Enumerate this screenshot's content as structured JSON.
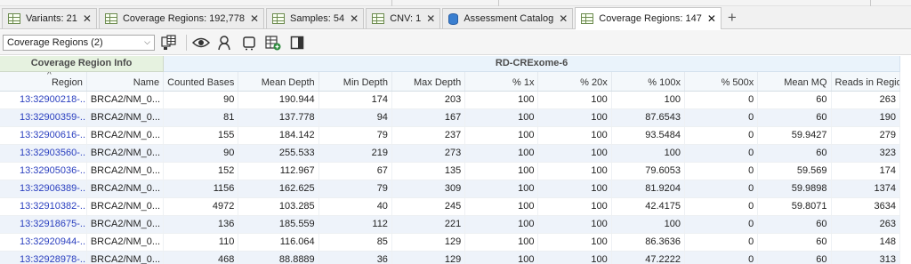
{
  "tabs": [
    {
      "label": "Variants: 21",
      "icon": "grid-icon",
      "active": false
    },
    {
      "label": "Coverage Regions: 192,778",
      "icon": "grid-icon",
      "active": false
    },
    {
      "label": "Samples: 54",
      "icon": "grid-icon",
      "active": false
    },
    {
      "label": "CNV: 1",
      "icon": "grid-icon",
      "active": false
    },
    {
      "label": "Assessment Catalog",
      "icon": "database-icon",
      "active": false
    },
    {
      "label": "Coverage Regions: 147",
      "icon": "grid-icon",
      "active": true
    }
  ],
  "tab_close_glyph": "✕",
  "new_tab_glyph": "+",
  "toolbar": {
    "view_select_value": "Coverage Regions (2)"
  },
  "table": {
    "groups": {
      "info": "Coverage Region Info",
      "sample": "RD-CRExome-6"
    },
    "columns": [
      "Region",
      "Name",
      "Counted Bases",
      "Mean Depth",
      "Min Depth",
      "Max Depth",
      "% 1x",
      "% 20x",
      "% 100x",
      "% 500x",
      "Mean MQ",
      "Reads in Region"
    ],
    "sort_indicator": "^",
    "rows": [
      [
        "13:32900218-...",
        "BRCA2/NM_0...",
        "90",
        "190.944",
        "174",
        "203",
        "100",
        "100",
        "100",
        "0",
        "60",
        "263"
      ],
      [
        "13:32900359-...",
        "BRCA2/NM_0...",
        "81",
        "137.778",
        "94",
        "167",
        "100",
        "100",
        "87.6543",
        "0",
        "60",
        "190"
      ],
      [
        "13:32900616-...",
        "BRCA2/NM_0...",
        "155",
        "184.142",
        "79",
        "237",
        "100",
        "100",
        "93.5484",
        "0",
        "59.9427",
        "279"
      ],
      [
        "13:32903560-...",
        "BRCA2/NM_0...",
        "90",
        "255.533",
        "219",
        "273",
        "100",
        "100",
        "100",
        "0",
        "60",
        "323"
      ],
      [
        "13:32905036-...",
        "BRCA2/NM_0...",
        "152",
        "112.967",
        "67",
        "135",
        "100",
        "100",
        "79.6053",
        "0",
        "59.569",
        "174"
      ],
      [
        "13:32906389-...",
        "BRCA2/NM_0...",
        "1156",
        "162.625",
        "79",
        "309",
        "100",
        "100",
        "81.9204",
        "0",
        "59.9898",
        "1374"
      ],
      [
        "13:32910382-...",
        "BRCA2/NM_0...",
        "4972",
        "103.285",
        "40",
        "245",
        "100",
        "100",
        "42.4175",
        "0",
        "59.8071",
        "3634"
      ],
      [
        "13:32918675-...",
        "BRCA2/NM_0...",
        "136",
        "185.559",
        "112",
        "221",
        "100",
        "100",
        "100",
        "0",
        "60",
        "263"
      ],
      [
        "13:32920944-...",
        "BRCA2/NM_0...",
        "110",
        "116.064",
        "85",
        "129",
        "100",
        "100",
        "86.3636",
        "0",
        "60",
        "148"
      ],
      [
        "13:32928978-...",
        "BRCA2/NM_0...",
        "468",
        "88.8889",
        "36",
        "129",
        "100",
        "100",
        "47.2222",
        "0",
        "60",
        "313"
      ]
    ]
  },
  "colors": {
    "link": "#2a3fbf",
    "group_info_bg": "#e6f2e0",
    "group_sample_bg": "#eaf3fb",
    "row_alt_bg": "#eef3fa"
  }
}
